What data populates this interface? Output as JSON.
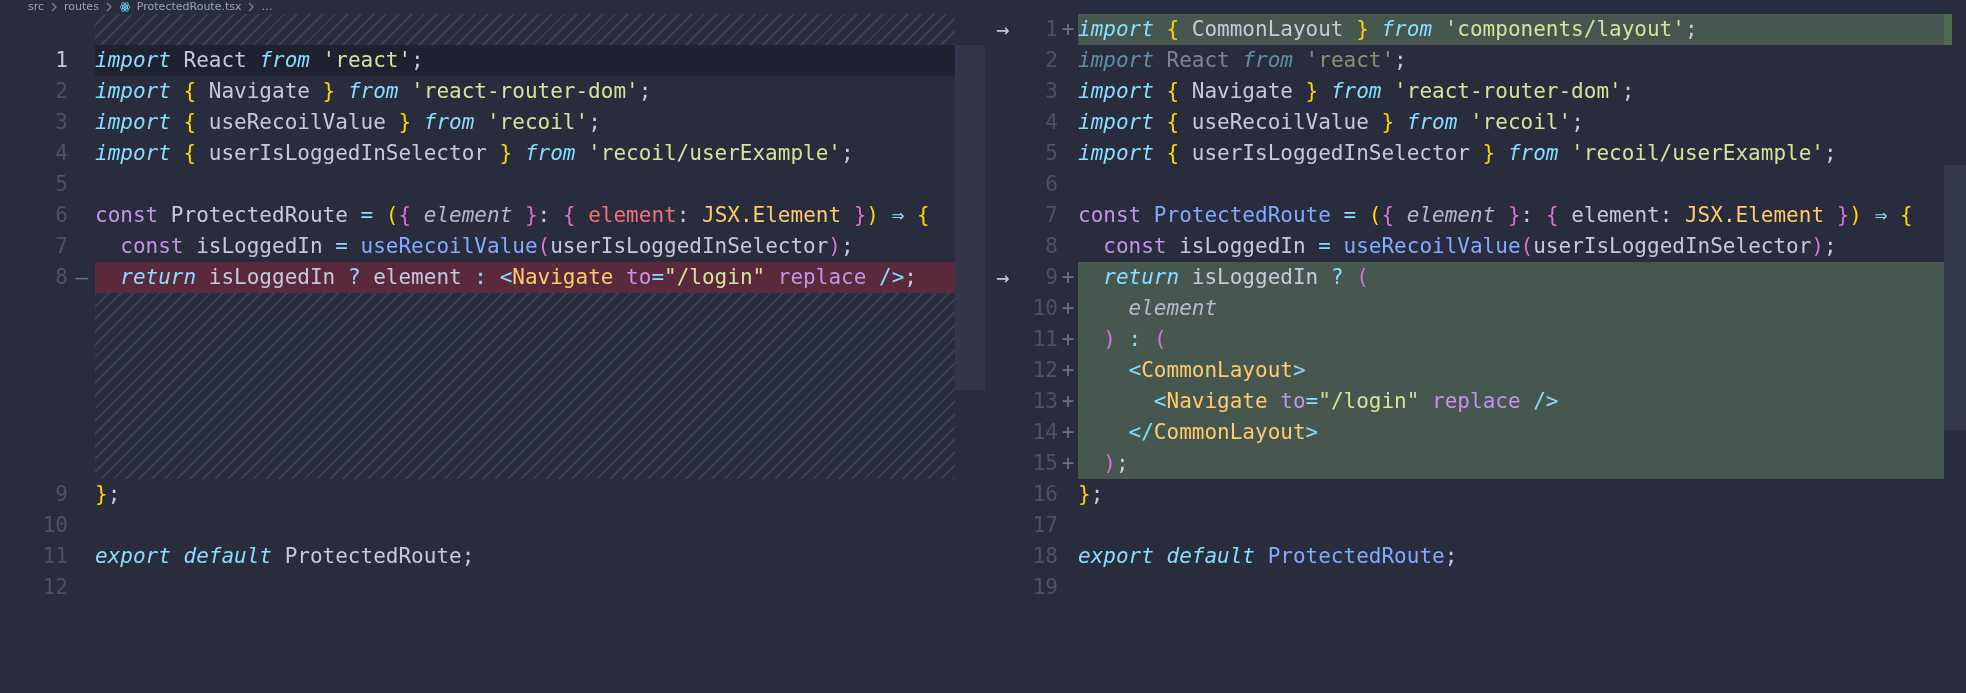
{
  "breadcrumb": [
    "src",
    "routes",
    "ProtectedRoute.tsx",
    "…"
  ],
  "left": {
    "lines": [
      {
        "kind": "filler"
      },
      {
        "kind": "code",
        "number": "1",
        "current": true,
        "tokens": [
          {
            "kind": "kw",
            "text": "import"
          },
          {
            "kind": "plain",
            "text": " React "
          },
          {
            "kind": "kw",
            "text": "from"
          },
          {
            "kind": "str",
            "text": " 'react'"
          },
          {
            "kind": "plain",
            "text": ";"
          }
        ]
      },
      {
        "kind": "code",
        "number": "2",
        "current": false,
        "tokens": [
          {
            "kind": "kw",
            "text": "import"
          },
          {
            "kind": "brace1",
            "text": " {"
          },
          {
            "kind": "plain",
            "text": " Navigate "
          },
          {
            "kind": "brace1",
            "text": "}"
          },
          {
            "kind": "kw",
            "text": " from"
          },
          {
            "kind": "str",
            "text": " 'react-router-dom'"
          },
          {
            "kind": "plain",
            "text": ";"
          }
        ]
      },
      {
        "kind": "code",
        "number": "3",
        "current": false,
        "tokens": [
          {
            "kind": "kw",
            "text": "import"
          },
          {
            "kind": "brace1",
            "text": " {"
          },
          {
            "kind": "plain",
            "text": " useRecoilValue "
          },
          {
            "kind": "brace1",
            "text": "}"
          },
          {
            "kind": "kw",
            "text": " from"
          },
          {
            "kind": "str",
            "text": " 'recoil'"
          },
          {
            "kind": "plain",
            "text": ";"
          }
        ]
      },
      {
        "kind": "code",
        "number": "4",
        "current": false,
        "tokens": [
          {
            "kind": "kw",
            "text": "import"
          },
          {
            "kind": "brace1",
            "text": " {"
          },
          {
            "kind": "plain",
            "text": " userIsLoggedInSelector "
          },
          {
            "kind": "brace1",
            "text": "}"
          },
          {
            "kind": "kw",
            "text": " from"
          },
          {
            "kind": "str",
            "text": " 'recoil/userExample'"
          },
          {
            "kind": "plain",
            "text": ";"
          }
        ]
      },
      {
        "kind": "code",
        "number": "5",
        "current": false
      },
      {
        "kind": "code",
        "number": "6",
        "current": false,
        "tokens": [
          {
            "kind": "storage",
            "text": "const"
          },
          {
            "kind": "plain",
            "text": " ProtectedRoute "
          },
          {
            "kind": "op",
            "text": "="
          },
          {
            "kind": "brace1",
            "text": " ("
          },
          {
            "kind": "brace2",
            "text": "{"
          },
          {
            "kind": "param",
            "text": " element"
          },
          {
            "kind": "brace2",
            "text": " }"
          },
          {
            "kind": "plain",
            "text": ":"
          },
          {
            "kind": "brace2",
            "text": " {"
          },
          {
            "kind": "prop",
            "text": " element"
          },
          {
            "kind": "plain",
            "text": ":"
          },
          {
            "kind": "type",
            "text": " JSX.Element"
          },
          {
            "kind": "brace2",
            "text": " }"
          },
          {
            "kind": "brace1",
            "text": ")"
          },
          {
            "kind": "op",
            "text": " ⇒"
          },
          {
            "kind": "brace1",
            "text": " {"
          }
        ]
      },
      {
        "kind": "code",
        "number": "7",
        "current": false,
        "tokens": [
          {
            "kind": "storage",
            "text": "  const"
          },
          {
            "kind": "plain",
            "text": " isLoggedIn "
          },
          {
            "kind": "op",
            "text": "="
          },
          {
            "kind": "func",
            "text": " useRecoilValue"
          },
          {
            "kind": "brace2",
            "text": "("
          },
          {
            "kind": "plain",
            "text": "userIsLoggedInSelector"
          },
          {
            "kind": "brace2",
            "text": ")"
          },
          {
            "kind": "plain",
            "text": ";"
          }
        ]
      },
      {
        "kind": "removed",
        "number": "8",
        "marker": "—",
        "current": false,
        "tokens": [
          {
            "kind": "kw",
            "text": "  return"
          },
          {
            "kind": "plain",
            "text": " isLoggedIn "
          },
          {
            "kind": "op",
            "text": "?"
          },
          {
            "kind": "plain",
            "text": " element "
          },
          {
            "kind": "op",
            "text": ":"
          },
          {
            "kind": "tag",
            "text": " <"
          },
          {
            "kind": "type",
            "text": "Navigate"
          },
          {
            "kind": "attr",
            "text": " to"
          },
          {
            "kind": "op",
            "text": "="
          },
          {
            "kind": "str",
            "text": "\"/login\""
          },
          {
            "kind": "attr",
            "text": " replace"
          },
          {
            "kind": "tag",
            "text": " />"
          },
          {
            "kind": "plain",
            "text": ";"
          }
        ]
      },
      {
        "kind": "filler"
      },
      {
        "kind": "filler"
      },
      {
        "kind": "filler"
      },
      {
        "kind": "filler"
      },
      {
        "kind": "filler"
      },
      {
        "kind": "filler"
      },
      {
        "kind": "code",
        "number": "9",
        "current": false,
        "tokens": [
          {
            "kind": "brace1",
            "text": "}"
          },
          {
            "kind": "plain",
            "text": ";"
          }
        ]
      },
      {
        "kind": "code",
        "number": "10",
        "current": false
      },
      {
        "kind": "code",
        "number": "11",
        "current": false,
        "tokens": [
          {
            "kind": "kw",
            "text": "export"
          },
          {
            "kind": "kw",
            "text": " default"
          },
          {
            "kind": "plain",
            "text": " ProtectedRoute;"
          }
        ]
      },
      {
        "kind": "code",
        "number": "12",
        "current": false
      }
    ]
  },
  "right": {
    "lines": [
      {
        "kind": "added",
        "number": "1",
        "marker": "+",
        "arrow": "→",
        "current": false,
        "tokens": [
          {
            "kind": "kw",
            "text": "import"
          },
          {
            "kind": "brace1",
            "text": " {"
          },
          {
            "kind": "plain",
            "text": " CommonLayout "
          },
          {
            "kind": "brace1",
            "text": "}"
          },
          {
            "kind": "kw",
            "text": " from"
          },
          {
            "kind": "str",
            "text": " 'components/layout'"
          },
          {
            "kind": "plain",
            "text": ";"
          }
        ]
      },
      {
        "kind": "code",
        "number": "2",
        "current": false,
        "tokens": [
          {
            "kind": "kw_dim",
            "text": "import"
          },
          {
            "kind": "plain_dim",
            "text": " React "
          },
          {
            "kind": "kw_dim",
            "text": "from"
          },
          {
            "kind": "str_dim",
            "text": " 'react'"
          },
          {
            "kind": "plain",
            "text": ";"
          }
        ]
      },
      {
        "kind": "code",
        "number": "3",
        "current": false,
        "tokens": [
          {
            "kind": "kw",
            "text": "import"
          },
          {
            "kind": "brace1",
            "text": " {"
          },
          {
            "kind": "plain",
            "text": " Navigate "
          },
          {
            "kind": "brace1",
            "text": "}"
          },
          {
            "kind": "kw",
            "text": " from"
          },
          {
            "kind": "str",
            "text": " 'react-router-dom'"
          },
          {
            "kind": "plain",
            "text": ";"
          }
        ]
      },
      {
        "kind": "code",
        "number": "4",
        "current": false,
        "tokens": [
          {
            "kind": "kw",
            "text": "import"
          },
          {
            "kind": "brace1",
            "text": " {"
          },
          {
            "kind": "plain",
            "text": " useRecoilValue "
          },
          {
            "kind": "brace1",
            "text": "}"
          },
          {
            "kind": "kw",
            "text": " from"
          },
          {
            "kind": "str",
            "text": " 'recoil'"
          },
          {
            "kind": "plain",
            "text": ";"
          }
        ]
      },
      {
        "kind": "code",
        "number": "5",
        "current": false,
        "tokens": [
          {
            "kind": "kw",
            "text": "import"
          },
          {
            "kind": "brace1",
            "text": " {"
          },
          {
            "kind": "plain",
            "text": " userIsLoggedInSelector "
          },
          {
            "kind": "brace1",
            "text": "}"
          },
          {
            "kind": "kw",
            "text": " from"
          },
          {
            "kind": "str",
            "text": " 'recoil/userExample'"
          },
          {
            "kind": "plain",
            "text": ";"
          }
        ]
      },
      {
        "kind": "code",
        "number": "6",
        "current": false
      },
      {
        "kind": "code",
        "number": "7",
        "current": false,
        "tokens": [
          {
            "kind": "storage",
            "text": "const"
          },
          {
            "kind": "func",
            "text": " ProtectedRoute"
          },
          {
            "kind": "op",
            "text": " ="
          },
          {
            "kind": "brace1",
            "text": " ("
          },
          {
            "kind": "brace2",
            "text": "{"
          },
          {
            "kind": "param",
            "text": " element"
          },
          {
            "kind": "brace2",
            "text": " }"
          },
          {
            "kind": "plain",
            "text": ":"
          },
          {
            "kind": "brace2",
            "text": " {"
          },
          {
            "kind": "plain",
            "text": " element:"
          },
          {
            "kind": "type",
            "text": " JSX.Element"
          },
          {
            "kind": "brace2",
            "text": " }"
          },
          {
            "kind": "brace1",
            "text": ")"
          },
          {
            "kind": "op",
            "text": " ⇒"
          },
          {
            "kind": "brace1",
            "text": " {"
          }
        ]
      },
      {
        "kind": "code",
        "number": "8",
        "current": false,
        "tokens": [
          {
            "kind": "storage",
            "text": "  const"
          },
          {
            "kind": "plain",
            "text": " isLoggedIn "
          },
          {
            "kind": "op",
            "text": "="
          },
          {
            "kind": "func",
            "text": " useRecoilValue"
          },
          {
            "kind": "brace2",
            "text": "("
          },
          {
            "kind": "plain",
            "text": "userIsLoggedInSelector"
          },
          {
            "kind": "brace2",
            "text": ")"
          },
          {
            "kind": "plain",
            "text": ";"
          }
        ]
      },
      {
        "kind": "added",
        "number": "9",
        "marker": "+",
        "arrow": "→",
        "current": false,
        "tokens": [
          {
            "kind": "kw",
            "text": "  return"
          },
          {
            "kind": "plain",
            "text": " isLoggedIn "
          },
          {
            "kind": "op",
            "text": "?"
          },
          {
            "kind": "brace2",
            "text": " ("
          }
        ]
      },
      {
        "kind": "added",
        "number": "10",
        "marker": "+",
        "current": false,
        "tokens": [
          {
            "kind": "param",
            "text": "    element"
          }
        ]
      },
      {
        "kind": "added",
        "number": "11",
        "marker": "+",
        "current": false,
        "tokens": [
          {
            "kind": "brace2",
            "text": "  )"
          },
          {
            "kind": "op",
            "text": " :"
          },
          {
            "kind": "brace2",
            "text": " ("
          }
        ]
      },
      {
        "kind": "added",
        "number": "12",
        "marker": "+",
        "current": false,
        "tokens": [
          {
            "kind": "tag",
            "text": "    <"
          },
          {
            "kind": "type",
            "text": "CommonLayout"
          },
          {
            "kind": "tag",
            "text": ">"
          }
        ]
      },
      {
        "kind": "added",
        "number": "13",
        "marker": "+",
        "current": false,
        "tokens": [
          {
            "kind": "tag",
            "text": "      <"
          },
          {
            "kind": "type",
            "text": "Navigate"
          },
          {
            "kind": "attr",
            "text": " to"
          },
          {
            "kind": "op",
            "text": "="
          },
          {
            "kind": "str",
            "text": "\"/login\""
          },
          {
            "kind": "attr",
            "text": " replace"
          },
          {
            "kind": "tag",
            "text": " />"
          }
        ]
      },
      {
        "kind": "added",
        "number": "14",
        "marker": "+",
        "current": false,
        "tokens": [
          {
            "kind": "tag",
            "text": "    </"
          },
          {
            "kind": "type",
            "text": "CommonLayout"
          },
          {
            "kind": "tag",
            "text": ">"
          }
        ]
      },
      {
        "kind": "added",
        "number": "15",
        "marker": "+",
        "current": false,
        "tokens": [
          {
            "kind": "brace2",
            "text": "  )"
          },
          {
            "kind": "plain",
            "text": ";"
          }
        ]
      },
      {
        "kind": "code",
        "number": "16",
        "current": false,
        "tokens": [
          {
            "kind": "brace1",
            "text": "}"
          },
          {
            "kind": "plain",
            "text": ";"
          }
        ]
      },
      {
        "kind": "code",
        "number": "17",
        "current": false
      },
      {
        "kind": "code",
        "number": "18",
        "current": false,
        "tokens": [
          {
            "kind": "kw",
            "text": "export"
          },
          {
            "kind": "kw",
            "text": " default"
          },
          {
            "kind": "func",
            "text": " ProtectedRoute"
          },
          {
            "kind": "plain",
            "text": ";"
          }
        ]
      },
      {
        "kind": "code",
        "number": "19",
        "current": false
      }
    ]
  }
}
